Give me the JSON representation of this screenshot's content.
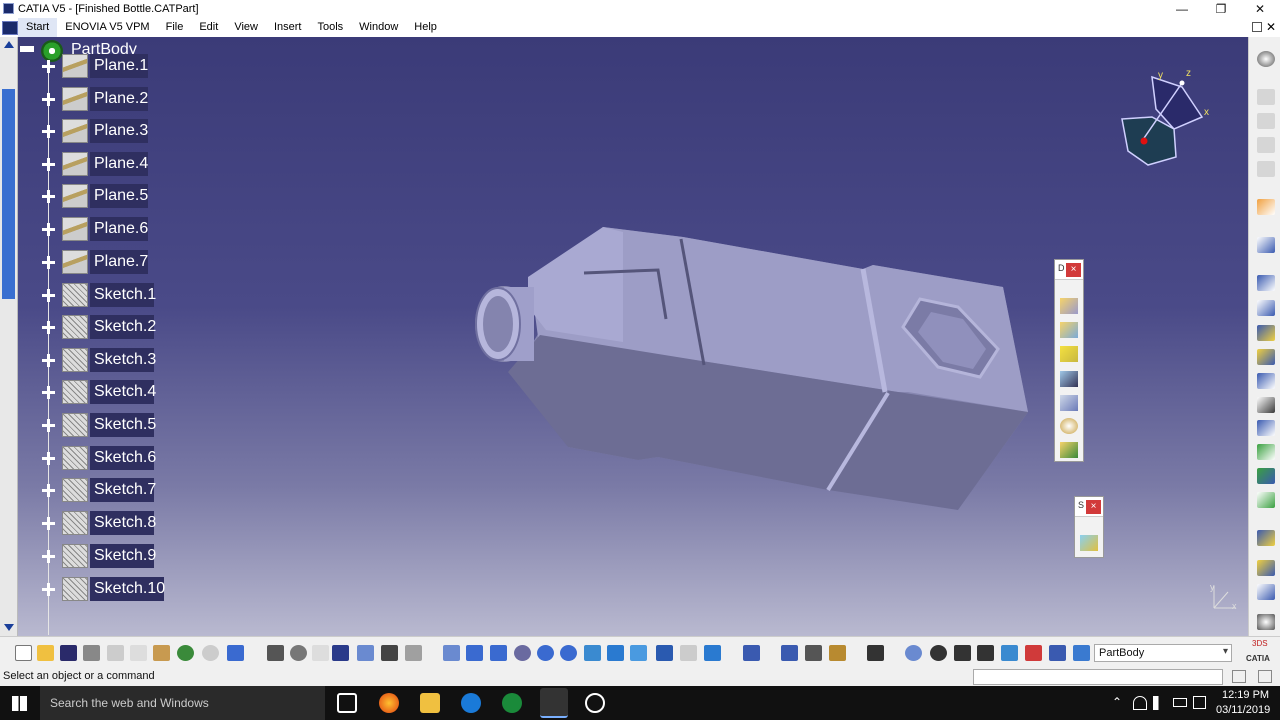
{
  "window": {
    "title": "CATIA V5 - [Finished Bottle.CATPart]",
    "minimize_glyph": "—",
    "maximize_glyph": "❐",
    "close_glyph": "✕"
  },
  "menu": {
    "items": [
      "Start",
      "ENOVIA V5 VPM",
      "File",
      "Edit",
      "View",
      "Insert",
      "Tools",
      "Window",
      "Help"
    ]
  },
  "tree": {
    "root": "PartBody",
    "items": [
      {
        "label": "Plane.1",
        "icon": "plane-icon"
      },
      {
        "label": "Plane.2",
        "icon": "plane-icon"
      },
      {
        "label": "Plane.3",
        "icon": "plane-icon"
      },
      {
        "label": "Plane.4",
        "icon": "plane-icon"
      },
      {
        "label": "Plane.5",
        "icon": "plane-icon"
      },
      {
        "label": "Plane.6",
        "icon": "plane-icon"
      },
      {
        "label": "Plane.7",
        "icon": "plane-icon"
      },
      {
        "label": "Sketch.1",
        "icon": "sketch-icon"
      },
      {
        "label": "Sketch.2",
        "icon": "sketch-icon"
      },
      {
        "label": "Sketch.3",
        "icon": "sketch-icon"
      },
      {
        "label": "Sketch.4",
        "icon": "sketch-icon"
      },
      {
        "label": "Sketch.5",
        "icon": "sketch-icon"
      },
      {
        "label": "Sketch.6",
        "icon": "sketch-icon"
      },
      {
        "label": "Sketch.7",
        "icon": "sketch-icon"
      },
      {
        "label": "Sketch.8",
        "icon": "sketch-icon"
      },
      {
        "label": "Sketch.9",
        "icon": "sketch-icon"
      },
      {
        "label": "Sketch.10",
        "icon": "sketch-icon"
      }
    ]
  },
  "compass": {
    "x_label": "x",
    "y_label": "y",
    "z_label": "z"
  },
  "axis_triad": {
    "x_label": "x",
    "y_label": "y"
  },
  "floating_panels": {
    "panel1": {
      "title": "D",
      "close": "×"
    },
    "panel2": {
      "title": "S",
      "close": "×"
    }
  },
  "bottom_toolbar": {
    "body_select": {
      "value": "PartBody"
    },
    "brand_text": "CATIA",
    "brand_mark": "3DS"
  },
  "status": {
    "text": "Select an object or a command"
  },
  "taskbar": {
    "search_placeholder": "Search the web and Windows",
    "time": "12:19 PM",
    "date": "03/11/2019"
  },
  "colors": {
    "viewport_top": "#3b3b78",
    "viewport_bottom": "#b9b9d0",
    "tree_label_bg": "#2f2f60",
    "part_face": "#8f8fb8"
  }
}
